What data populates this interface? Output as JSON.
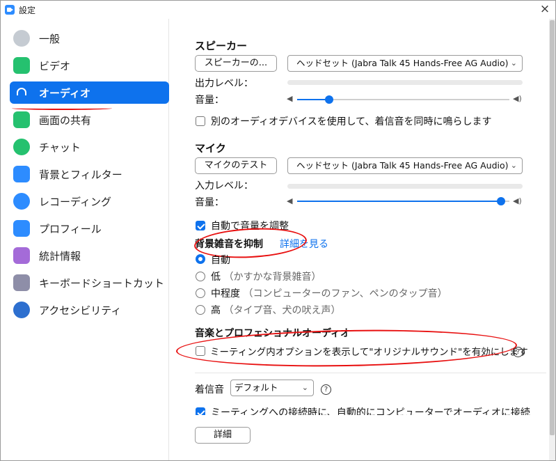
{
  "window": {
    "title": "設定",
    "close": "×"
  },
  "sidebar": {
    "items": [
      {
        "label": "一般",
        "icon": "gear-icon",
        "color": "#b9c0c8"
      },
      {
        "label": "ビデオ",
        "icon": "video-icon",
        "color": "#25c16f"
      },
      {
        "label": "オーディオ",
        "icon": "headphones-icon",
        "color": "#0e72ed",
        "active": true
      },
      {
        "label": "画面の共有",
        "icon": "share-screen-icon",
        "color": "#25c16f"
      },
      {
        "label": "チャット",
        "icon": "chat-icon",
        "color": "#25c16f"
      },
      {
        "label": "背景とフィルター",
        "icon": "background-icon",
        "color": "#2d8cff"
      },
      {
        "label": "レコーディング",
        "icon": "record-icon",
        "color": "#2d8cff"
      },
      {
        "label": "プロフィール",
        "icon": "profile-icon",
        "color": "#2d8cff"
      },
      {
        "label": "統計情報",
        "icon": "statistics-icon",
        "color": "#a46bd8"
      },
      {
        "label": "キーボードショートカット",
        "icon": "keyboard-icon",
        "color": "#8e8ea8"
      },
      {
        "label": "アクセシビリティ",
        "icon": "accessibility-icon",
        "color": "#2d6fcf"
      }
    ]
  },
  "speaker": {
    "heading": "スピーカー",
    "test_button": "スピーカーの...",
    "device": "ヘッドセット (Jabra Talk 45 Hands-Free AG Audio)",
    "output_level_label": "出力レベル：",
    "volume_label": "音量：",
    "volume": 0.15
  },
  "separate_device": {
    "label": "別のオーディオデバイスを使用して、着信音を同時に鳴らします",
    "checked": false
  },
  "mic": {
    "heading": "マイク",
    "test_button": "マイクのテスト",
    "device": "ヘッドセット (Jabra Talk 45 Hands-Free AG Audio)",
    "input_level_label": "入力レベル：",
    "volume_label": "音量：",
    "volume": 0.96
  },
  "auto_volume": {
    "label": "自動で音量を調整",
    "checked": true
  },
  "noise": {
    "heading": "背景雑音を抑制",
    "link": "詳細を見る",
    "options": [
      {
        "label": "自動",
        "hint": "",
        "checked": true
      },
      {
        "label": "低",
        "hint": "（かすかな背景雑音）",
        "checked": false
      },
      {
        "label": "中程度",
        "hint": "（コンピューターのファン、ペンのタップ音）",
        "checked": false
      },
      {
        "label": "高",
        "hint": "（タイプ音、犬の吠え声）",
        "checked": false
      }
    ]
  },
  "music": {
    "heading": "音楽とプロフェショナルオーディオ",
    "option": "ミーティング内オプションを表示して\"オリジナルサウンド\"を有効にします",
    "checked": false,
    "help": "?"
  },
  "ringtone": {
    "label": "着信音",
    "value": "デフォルト",
    "help": "?"
  },
  "auto_join": {
    "label": "ミーティングへの接続時に、自動的にコンピューターでオーディオに接続",
    "checked": true
  },
  "details_button": "詳細",
  "colors": {
    "accent": "#0e72ed",
    "annotation": "#e81010"
  }
}
